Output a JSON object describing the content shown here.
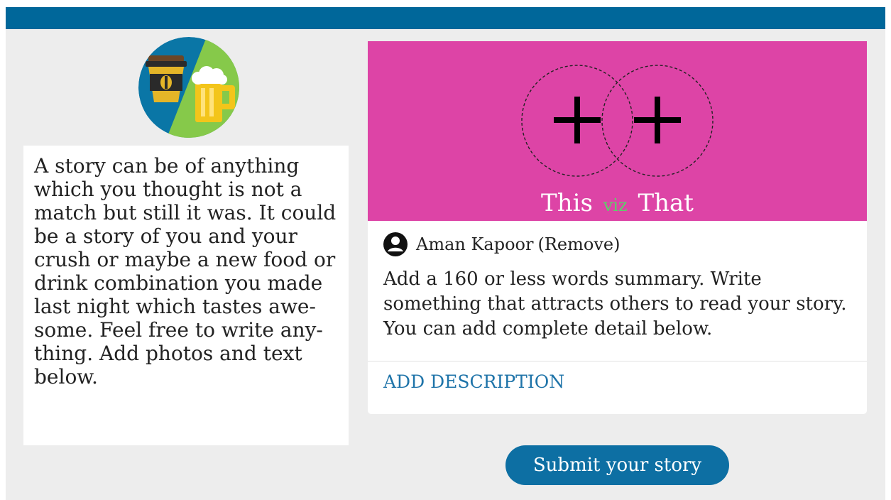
{
  "colors": {
    "header": "#00679a",
    "background": "#ededed",
    "cover": "#dd44a6",
    "viz_accent": "#5dcf6a",
    "link": "#1f74a9",
    "submit": "#0d6fa3"
  },
  "intro": {
    "logo_icon": "coffee-and-beer-icon",
    "text": "A story can be of anything which you thought is not a match but still it was. It could be a story of you and your crush or maybe a new food or drink combination you made last night which tastes awe-some. Feel free to write any-thing. Add photos and text below."
  },
  "story": {
    "cover": {
      "icon": "plus-icon",
      "this_label": "This",
      "viz_label": "viz",
      "that_label": "That"
    },
    "author": {
      "icon": "user-circle-icon",
      "name": "Aman Kapoor",
      "remove_label": "(Remove)"
    },
    "summary": "Add a 160 or less words summary. Write something that attracts others to read your story. You can add complete detail below.",
    "add_description_label": "ADD DESCRIPTION"
  },
  "submit_label": "Submit your story"
}
